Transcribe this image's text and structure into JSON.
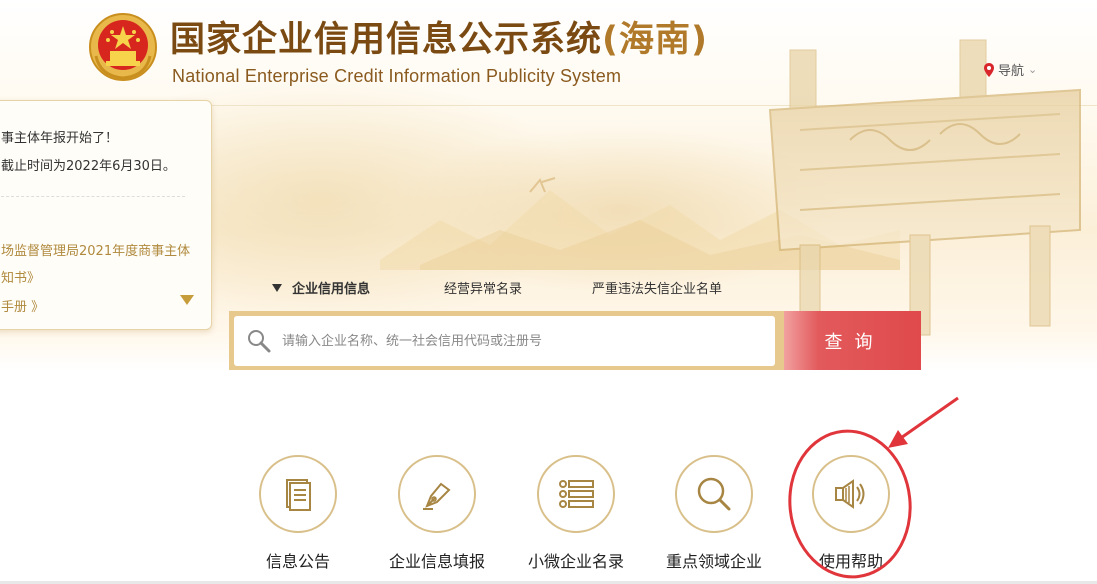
{
  "header": {
    "title_cn": "国家企业信用信息公示系统",
    "title_region": "(海南)",
    "title_en": "National Enterprise Credit Information Publicity System",
    "nav_label": "导航"
  },
  "notice": {
    "line1": "事主体年报开始了！",
    "line2": "截止时间为2022年6月30日。",
    "line3": "场监督管理局2021年度商事主体",
    "line4": "知书》",
    "line5": "手册 》"
  },
  "search": {
    "tabs": [
      "企业信用信息",
      "经营异常名录",
      "严重违法失信企业名单"
    ],
    "placeholder": "请输入企业名称、统一社会信用代码或注册号",
    "button_label": "查询"
  },
  "quick_links": [
    {
      "label": "信息公告",
      "icon": "document-icon"
    },
    {
      "label": "企业信息填报",
      "icon": "pen-icon"
    },
    {
      "label": "小微企业名录",
      "icon": "list-icon"
    },
    {
      "label": "重点领域企业",
      "icon": "magnifier-icon"
    },
    {
      "label": "使用帮助",
      "icon": "speaker-icon"
    }
  ],
  "colors": {
    "brand_brown": "#7a4a12",
    "gold_accent": "#d9c08a",
    "search_button_red": "#e04a4c",
    "annotation_red": "#e0353b"
  }
}
